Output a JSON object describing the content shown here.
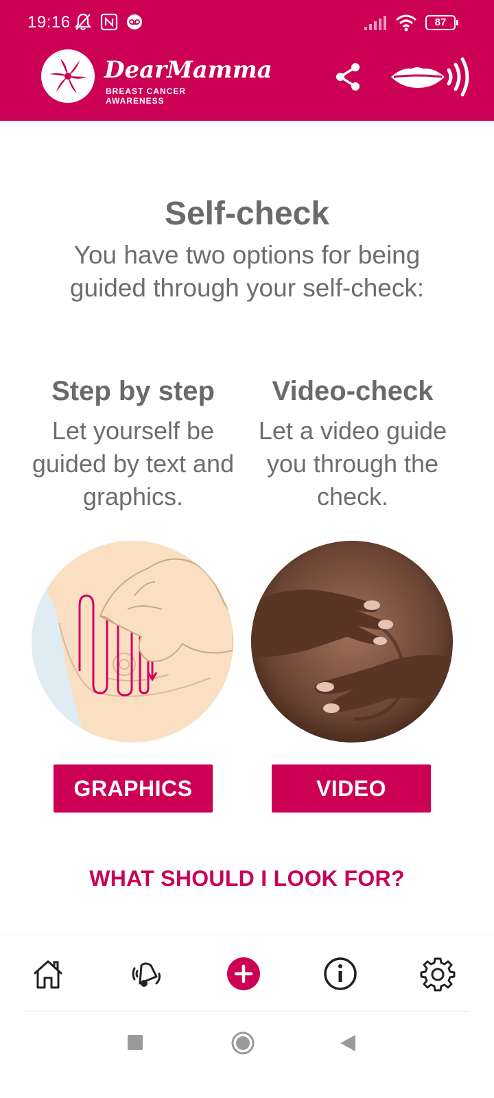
{
  "status_bar": {
    "time": "19:16",
    "battery": "87"
  },
  "header": {
    "brand_name": "DearMamma",
    "brand_subtitle": "BREAST CANCER AWARENESS",
    "background_color": "#cc0055"
  },
  "main": {
    "title": "Self-check",
    "subtitle": "You have two options for being guided through your self-check:",
    "options": [
      {
        "title": "Step by step",
        "description": "Let yourself be guided by text and graphics.",
        "button_label": "GRAPHICS"
      },
      {
        "title": "Video-check",
        "description": "Let a video guide you through the check.",
        "button_label": "VIDEO"
      }
    ],
    "link_label": "WHAT SHOULD I LOOK FOR?"
  },
  "bottom_nav": {
    "items": [
      {
        "icon": "home-icon"
      },
      {
        "icon": "reminder-icon"
      },
      {
        "icon": "add-icon",
        "active": true
      },
      {
        "icon": "info-icon"
      },
      {
        "icon": "settings-icon"
      }
    ],
    "active_color": "#cc0055"
  }
}
